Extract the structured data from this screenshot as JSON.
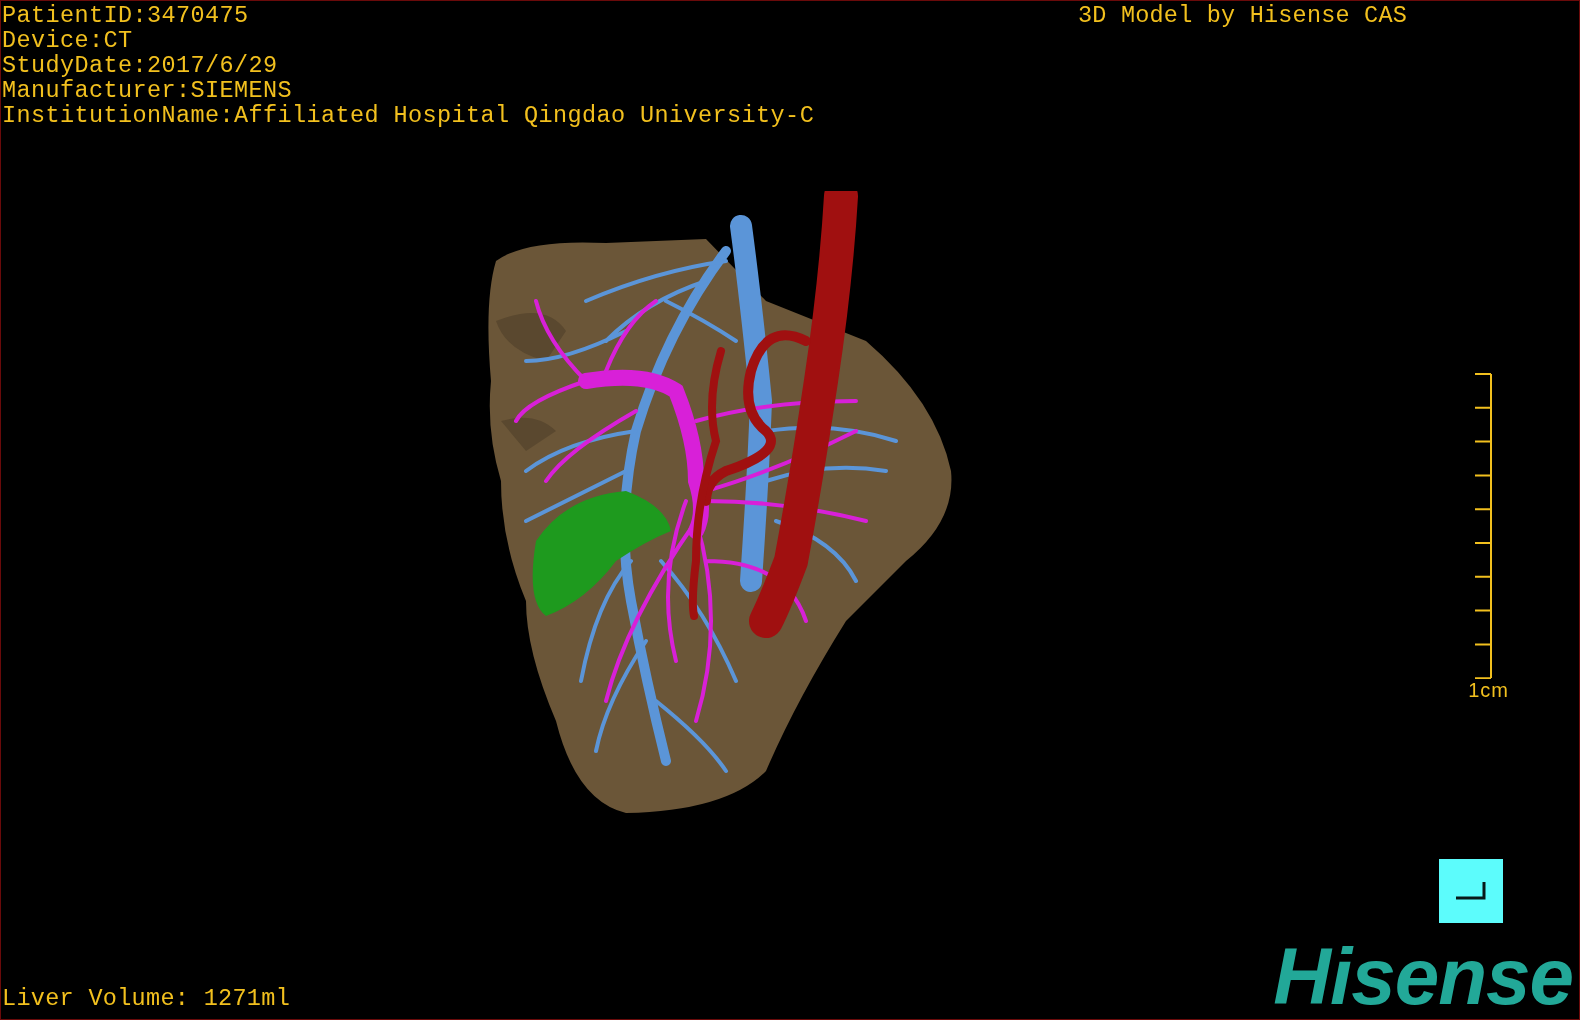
{
  "patient_info": [
    "PatientID:3470475",
    "Device:CT",
    "StudyDate:2017/6/29",
    "Manufacturer:SIEMENS",
    "InstitutionName:Affiliated Hospital Qingdao University-C"
  ],
  "model_title": "3D Model by Hisense CAS",
  "scale_bar": {
    "label": "1cm"
  },
  "liver_volume": "Liver Volume: 1271ml",
  "logo": "Hisense"
}
